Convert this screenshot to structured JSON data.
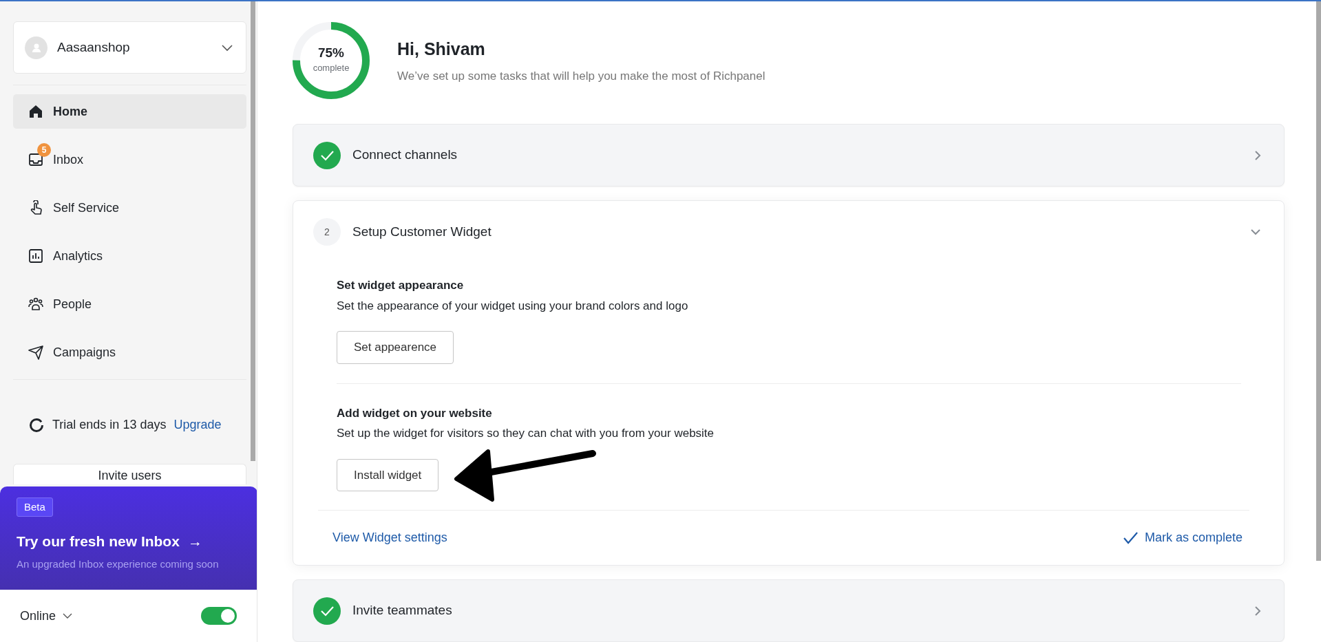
{
  "account": {
    "name": "Aasaanshop"
  },
  "nav": [
    {
      "label": "Home",
      "selected": true
    },
    {
      "label": "Inbox",
      "selected": false,
      "badge": "5"
    },
    {
      "label": "Self Service",
      "selected": false
    },
    {
      "label": "Analytics",
      "selected": false
    },
    {
      "label": "People",
      "selected": false
    },
    {
      "label": "Campaigns",
      "selected": false
    }
  ],
  "trial": {
    "text": "Trial ends in 13 days",
    "link": "Upgrade"
  },
  "invite_button": "Invite users",
  "promo": {
    "tag": "Beta",
    "title": "Try our fresh new Inbox",
    "arrow": "→",
    "subtitle": "An upgraded Inbox experience coming soon"
  },
  "status": {
    "label": "Online",
    "on": true
  },
  "progress": {
    "level": 0.75,
    "percent": "75%",
    "caption": "complete"
  },
  "greeting": {
    "title": "Hi, Shivam",
    "subtitle": "We’ve set up some tasks that will help you make the most of Richpanel"
  },
  "tasks": [
    {
      "title": "Connect channels",
      "done": true,
      "expanded": false
    },
    {
      "number": "2",
      "title": "Setup Customer Widget",
      "done": false,
      "expanded": true,
      "steps": [
        {
          "title": "Set widget appearance",
          "description": "Set the appearance of your widget using your brand colors and logo",
          "button": "Set appearence"
        },
        {
          "title": "Add widget on your website",
          "description": "Set up the widget for visitors so they can chat with you from your website",
          "button": "Install widget"
        }
      ],
      "footer_link": "View Widget settings",
      "complete_action": "Mark as complete"
    },
    {
      "title": "Invite teammates",
      "done": true,
      "expanded": false
    }
  ]
}
